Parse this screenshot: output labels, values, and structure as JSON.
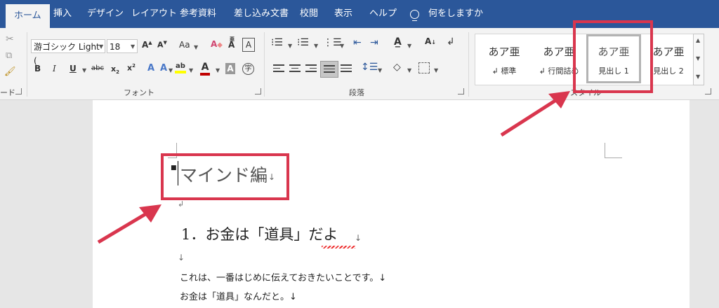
{
  "tabs": [
    {
      "label": "ホーム",
      "active": true
    },
    {
      "label": "挿入"
    },
    {
      "label": "デザイン"
    },
    {
      "label": "レイアウト"
    },
    {
      "label": "参考資料"
    },
    {
      "label": "差し込み文書"
    },
    {
      "label": "校閲"
    },
    {
      "label": "表示"
    },
    {
      "label": "ヘルプ"
    },
    {
      "label": "何をしますか"
    }
  ],
  "font": {
    "name": "游ゴシック Light (",
    "size": "18",
    "group_label": "フォント",
    "clipboard_label_fragment": "ード"
  },
  "paragraph": {
    "group_label": "段落"
  },
  "styles": {
    "group_label": "スタイル",
    "items": [
      {
        "sample": "あア亜",
        "name": "↲ 標準"
      },
      {
        "sample": "あア亜",
        "name": "↲ 行間詰め"
      },
      {
        "sample": "あア亜",
        "name": "見出し 1",
        "selected": true
      },
      {
        "sample": "あア亜",
        "name": "見出し 2"
      }
    ]
  },
  "document": {
    "heading": "マインド編",
    "section_title": "1．お金は「道具」だよ",
    "body_lines": [
      "これは、一番はじめに伝えておきたいことです。↓",
      "お金は「道具」なんだと。↓"
    ],
    "para_mark": "↲",
    "line_mark": "↓"
  },
  "colors": {
    "ribbon_blue": "#2b579a",
    "highlight_red": "#d9364e",
    "font_color_red": "#c00000",
    "highlight_yellow": "#ffff00"
  }
}
